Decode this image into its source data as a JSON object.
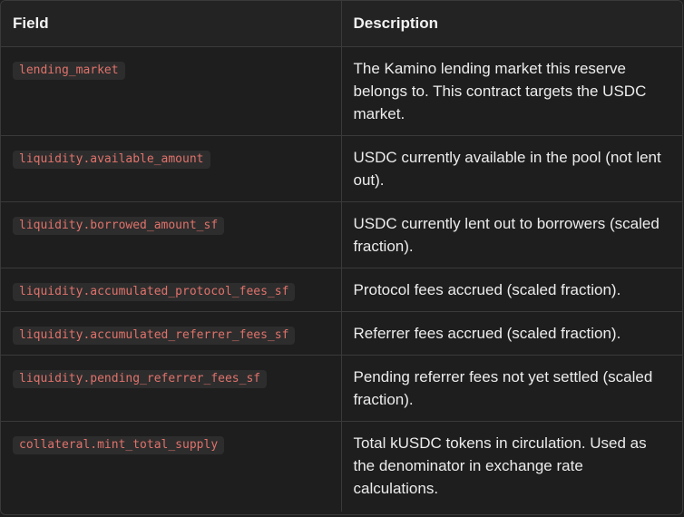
{
  "table": {
    "headers": {
      "field": "Field",
      "description": "Description"
    },
    "rows": [
      {
        "field": "lending_market",
        "description": "The Kamino lending market this reserve belongs to. This contract targets the USDC market."
      },
      {
        "field": "liquidity.available_amount",
        "description": "USDC currently available in the pool (not lent out)."
      },
      {
        "field": "liquidity.borrowed_amount_sf",
        "description": "USDC currently lent out to borrowers (scaled fraction)."
      },
      {
        "field": "liquidity.accumulated_protocol_fees_sf",
        "description": "Protocol fees accrued (scaled fraction)."
      },
      {
        "field": "liquidity.accumulated_referrer_fees_sf",
        "description": "Referrer fees accrued (scaled fraction)."
      },
      {
        "field": "liquidity.pending_referrer_fees_sf",
        "description": "Pending referrer fees not yet settled (scaled fraction)."
      },
      {
        "field": "collateral.mint_total_supply",
        "description": "Total kUSDC tokens in circulation. Used as the denominator in exchange rate calculations."
      }
    ]
  },
  "colors": {
    "background": "#1e1e1e",
    "code_text": "#e0726b",
    "code_bg": "#2d2d2d",
    "border": "#3a3a3a"
  }
}
